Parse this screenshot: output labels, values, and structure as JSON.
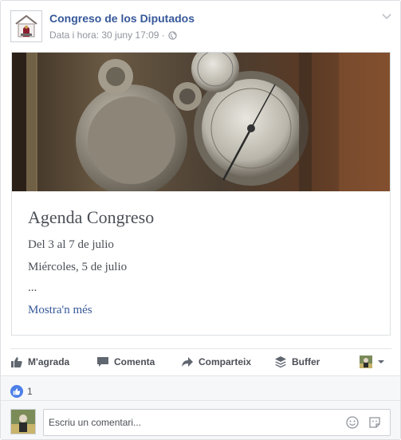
{
  "post": {
    "page_name": "Congreso de los Diputados",
    "meta_label": "Data i hora: 30 juny 17:09 ·",
    "privacy_icon": "globe-icon"
  },
  "card": {
    "title": "Agenda Congreso",
    "lines": [
      "Del 3 al 7 de julio",
      "Miércoles, 5 de julio",
      "..."
    ],
    "more": "Mostra'n més"
  },
  "actions": {
    "like": "M'agrada",
    "comment": "Comenta",
    "share": "Comparteix",
    "buffer": "Buffer"
  },
  "reactions": {
    "count": "1"
  },
  "comment_box": {
    "placeholder": "Escriu un comentari..."
  },
  "colors": {
    "link_blue": "#365899",
    "like_blue": "#4c7fe8",
    "text_grey": "#4b4f56"
  }
}
